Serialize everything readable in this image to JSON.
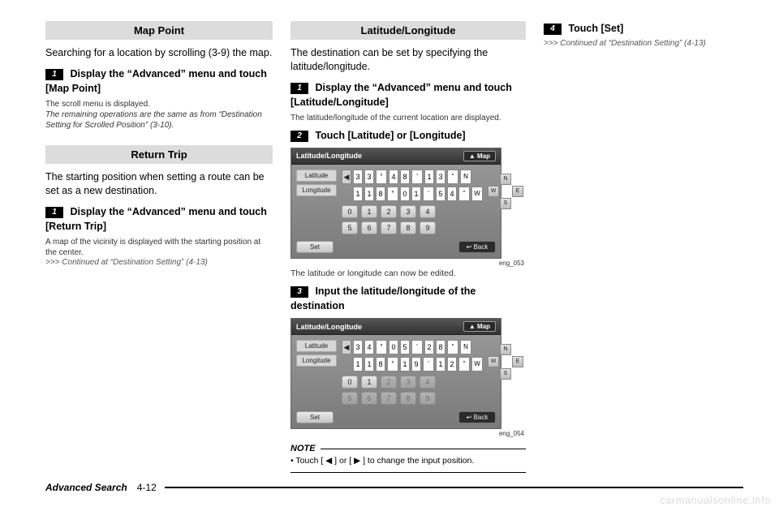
{
  "col1": {
    "mapPoint": {
      "heading": "Map Point",
      "body": "Searching for a location by scrolling (3-9) the map.",
      "step1_num": "1",
      "step1_text": "Display the “Advanced” menu and touch [Map Point]",
      "note1": "The scroll menu is displayed.",
      "note2": "The remaining operations are the same as from “Destination Setting for Scrolled Position” (3-10)."
    },
    "returnTrip": {
      "heading": "Return Trip",
      "body": "The starting position when setting a route can be set as a new destination.",
      "step1_num": "1",
      "step1_text": "Display the “Advanced” menu and touch [Return Trip]",
      "note1": "A map of the vicinity is displayed with the starting position at the center.",
      "cont": ">>> Continued at “Destination Setting” (4-13)"
    }
  },
  "col2": {
    "latlon": {
      "heading": "Latitude/Longitude",
      "body": "The destination can be set by specifying the latitude/longitude.",
      "step1_num": "1",
      "step1_text": "Display the “Advanced” menu and touch [Latitude/Longitude]",
      "note1": "The latitude/longitude of the current location are displayed.",
      "step2_num": "2",
      "step2_text": "Touch [Latitude] or [Longitude]",
      "shot1": {
        "title": "Latitude/Longitude",
        "map": "▲ Map",
        "tab_lat": "Latitude",
        "tab_lon": "Longitude",
        "row1": [
          "3",
          "3",
          "°",
          "4",
          "8",
          "'",
          "1",
          "3",
          "\"",
          "N"
        ],
        "row2": [
          "1",
          "1",
          "8",
          "°",
          "0",
          "1",
          "'",
          "5",
          "4",
          "\"",
          "W"
        ],
        "keys": [
          "0",
          "1",
          "2",
          "3",
          "4",
          "5",
          "6",
          "7",
          "8",
          "9"
        ],
        "set": "Set",
        "back": "↩ Back",
        "caption": "eng_053"
      },
      "after1": "The latitude or longitude can now be edited.",
      "step3_num": "3",
      "step3_text": "Input the latitude/longitude of the destination",
      "shot2": {
        "title": "Latitude/Longitude",
        "map": "▲ Map",
        "tab_lat": "Latitude",
        "tab_lon": "Longitude",
        "row1": [
          "3",
          "4",
          "°",
          "0",
          "5",
          "'",
          "2",
          "8",
          "\"",
          "N"
        ],
        "row2": [
          "1",
          "1",
          "8",
          "°",
          "1",
          "9",
          "'",
          "1",
          "2",
          "\"",
          "W"
        ],
        "keys": [
          "0",
          "1",
          "2",
          "3",
          "4",
          "5",
          "6",
          "7",
          "8",
          "9"
        ],
        "set": "Set",
        "back": "↩ Back",
        "caption": "eng_054"
      },
      "note_label": "NOTE",
      "note_body": "• Touch [ ◀ ] or [ ▶ ] to change the input position."
    }
  },
  "col3": {
    "step4_num": "4",
    "step4_text": "Touch [Set]",
    "cont": ">>> Continued at “Destination Setting” (4-13)"
  },
  "footer": {
    "title": "Advanced Search",
    "page": "4-12"
  },
  "watermark": "carmanualsonline.info",
  "compass": {
    "N": "N",
    "S": "S",
    "E": "E",
    "W": "W"
  },
  "ui": {
    "arrow_left": "◀",
    "arrow_right": "▶"
  }
}
